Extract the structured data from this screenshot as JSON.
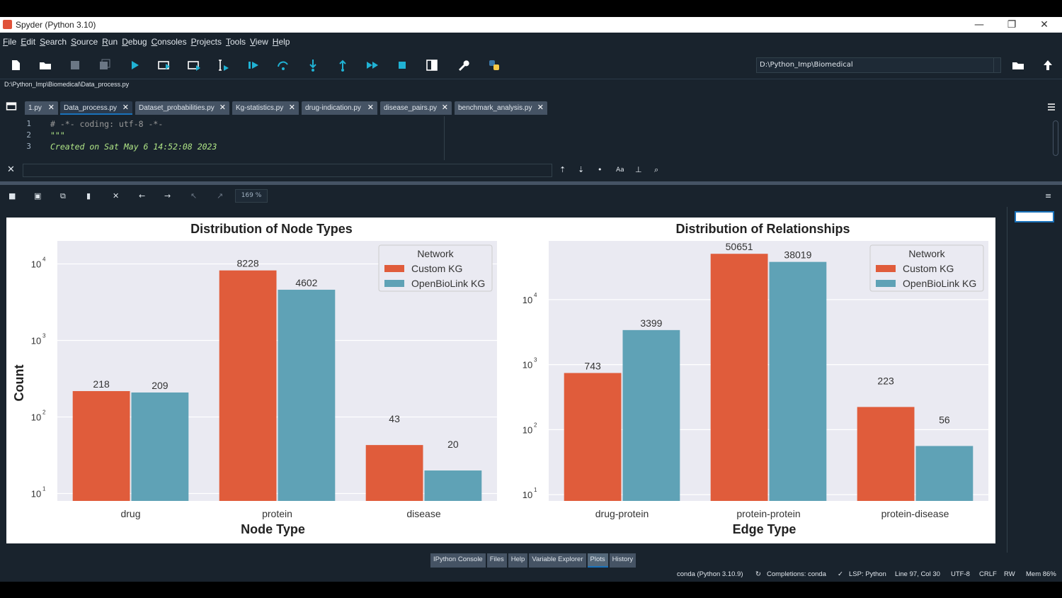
{
  "window": {
    "title": "Spyder (Python 3.10)",
    "minimize": "—",
    "maximize": "❐",
    "close": "✕"
  },
  "menu": [
    "File",
    "Edit",
    "Search",
    "Source",
    "Run",
    "Debug",
    "Consoles",
    "Projects",
    "Tools",
    "View",
    "Help"
  ],
  "toolbar": {
    "path": "D:\\Python_Imp\\Biomedical"
  },
  "file_path": "D:\\Python_Imp\\Biomedical\\Data_process.py",
  "tabs": [
    "1.py",
    "Data_process.py",
    "Dataset_probabilities.py",
    "Kg-statistics.py",
    "drug-indication.py",
    "disease_pairs.py",
    "benchmark_analysis.py"
  ],
  "active_tab": "Data_process.py",
  "editor": {
    "line_numbers": [
      "1",
      "2",
      "3"
    ],
    "lines": [
      "# -*- coding: utf-8 -*-",
      "\"\"\"",
      "Created on Sat May  6 14:52:08 2023"
    ]
  },
  "find": {
    "close": "✕",
    "case_label": "Aa"
  },
  "plots": {
    "zoom": "169 %"
  },
  "chart_data": [
    {
      "type": "bar",
      "title": "Distribution of Node Types",
      "xlabel": "Node Type",
      "ylabel": "Count",
      "yscale": "log",
      "ylim": [
        8,
        20000
      ],
      "yticks": [
        "10",
        "10",
        "10",
        "10"
      ],
      "ytick_exponents": [
        "1",
        "2",
        "3",
        "4"
      ],
      "categories": [
        "drug",
        "protein",
        "disease"
      ],
      "series": [
        {
          "name": "Custom KG",
          "values": [
            218,
            8228,
            43
          ],
          "color": "#e05c3b"
        },
        {
          "name": "OpenBioLink KG",
          "values": [
            209,
            4602,
            20
          ],
          "color": "#5fa2b6"
        }
      ],
      "legend_title": "Network",
      "legend_position": "top-right",
      "grid": true
    },
    {
      "type": "bar",
      "title": "Distribution of Relationships",
      "xlabel": "Edge Type",
      "ylabel": "",
      "yscale": "log",
      "ylim": [
        8,
        80000
      ],
      "yticks": [
        "10",
        "10",
        "10",
        "10"
      ],
      "ytick_exponents": [
        "1",
        "2",
        "3",
        "4"
      ],
      "categories": [
        "drug-protein",
        "protein-protein",
        "protein-disease"
      ],
      "series": [
        {
          "name": "Custom KG",
          "values": [
            743,
            50651,
            223
          ],
          "color": "#e05c3b"
        },
        {
          "name": "OpenBioLink KG",
          "values": [
            3399,
            38019,
            56
          ],
          "color": "#5fa2b6"
        }
      ],
      "legend_title": "Network",
      "legend_position": "top-right",
      "grid": true
    }
  ],
  "pane_tabs": [
    "IPython Console",
    "Files",
    "Help",
    "Variable Explorer",
    "Plots",
    "History"
  ],
  "active_pane_tab": "Plots",
  "status": {
    "env": "conda (Python 3.10.9)",
    "completions": "Completions: conda",
    "lsp": "LSP: Python",
    "cursor": "Line 97, Col 30",
    "encoding": "UTF-8",
    "eol": "CRLF",
    "rw": "RW",
    "mem": "Mem 86%"
  }
}
